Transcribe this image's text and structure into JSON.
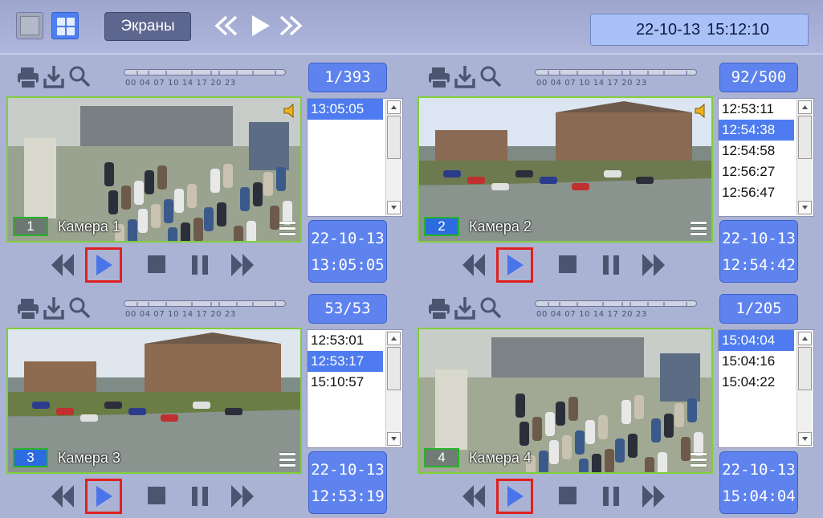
{
  "toolbar": {
    "screens_label": "Экраны",
    "date": "22-10-13",
    "time": "15:12:10"
  },
  "timeline_labels": "00 04 07 10  14 17 20 23",
  "panels": [
    {
      "counter": "1/393",
      "camera_number": "1",
      "camera_name": "Камера 1",
      "has_sound": true,
      "times": [
        {
          "text": "13:05:05",
          "selected": true
        }
      ],
      "date": "22-10-13",
      "time": "13:05:05"
    },
    {
      "counter": "92/500",
      "camera_number": "2",
      "camera_name": "Камера 2",
      "has_sound": true,
      "times": [
        {
          "text": "12:53:11",
          "selected": false
        },
        {
          "text": "12:54:38",
          "selected": true
        },
        {
          "text": "12:54:58",
          "selected": false
        },
        {
          "text": "12:56:27",
          "selected": false
        },
        {
          "text": "12:56:47",
          "selected": false
        }
      ],
      "date": "22-10-13",
      "time": "12:54:42"
    },
    {
      "counter": "53/53",
      "camera_number": "3",
      "camera_name": "Камера 3",
      "has_sound": false,
      "times": [
        {
          "text": "12:53:01",
          "selected": false
        },
        {
          "text": "12:53:17",
          "selected": true
        },
        {
          "text": "15:10:57",
          "selected": false
        }
      ],
      "date": "22-10-13",
      "time": "12:53:19"
    },
    {
      "counter": "1/205",
      "camera_number": "4",
      "camera_name": "Камера 4",
      "has_sound": false,
      "times": [
        {
          "text": "15:04:04",
          "selected": true
        },
        {
          "text": "15:04:16",
          "selected": false
        },
        {
          "text": "15:04:22",
          "selected": false
        }
      ],
      "date": "22-10-13",
      "time": "15:04:04"
    }
  ],
  "colors": {
    "accent": "#5f83ee",
    "frame": "#7fcf3a",
    "highlight": "#e02020"
  }
}
